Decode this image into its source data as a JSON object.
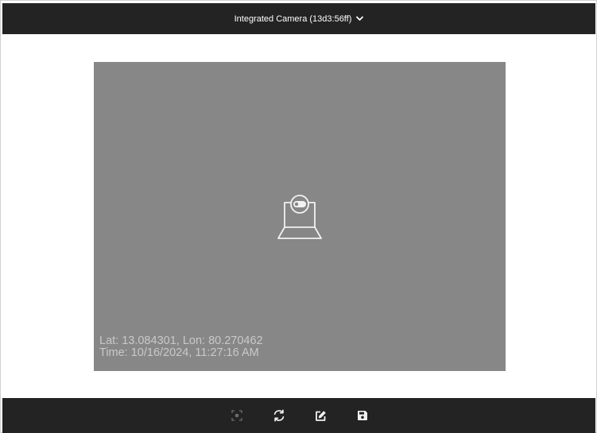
{
  "header": {
    "camera_label": "Integrated Camera (13d3:56ff)",
    "dropdown_icon": "chevron-down-icon"
  },
  "viewport": {
    "placeholder_icon": "camera-off-icon",
    "location_text": "Lat: 13.084301, Lon: 80.270462",
    "time_text": "Time: 10/16/2024, 11:27:16 AM"
  },
  "toolbar": {
    "items": [
      {
        "name": "capture",
        "icon": "capture-focus-icon",
        "enabled": false
      },
      {
        "name": "switch-camera",
        "icon": "refresh-icon",
        "enabled": true
      },
      {
        "name": "edit",
        "icon": "edit-icon",
        "enabled": true
      },
      {
        "name": "save",
        "icon": "save-icon",
        "enabled": true
      }
    ]
  },
  "colors": {
    "bar_background": "#232323",
    "viewport_background": "#878787",
    "overlay_text": "#c9c9c9",
    "icon_light": "#f0f0f0",
    "icon_disabled": "#6e6e6e"
  }
}
